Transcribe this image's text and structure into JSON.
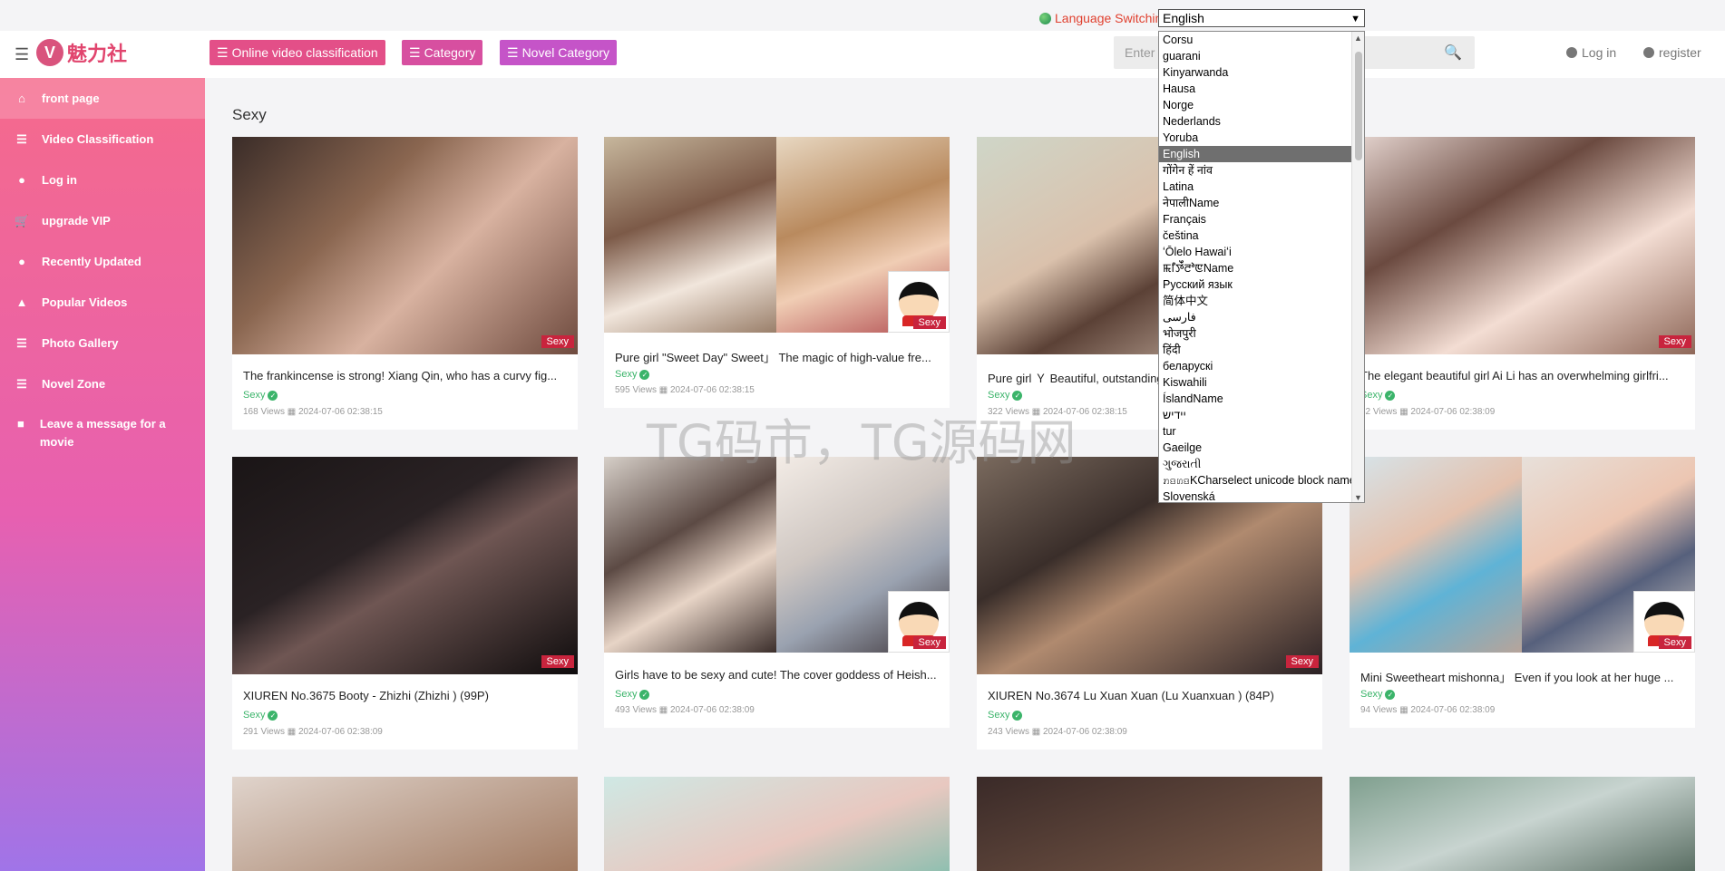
{
  "language": {
    "label": "Language Switching",
    "selected": "English",
    "options": [
      "Corsu",
      "guarani",
      "Kinyarwanda",
      "Hausa",
      "Norge",
      "Nederlands",
      "Yoruba",
      "English",
      "गोंगेन हें नांव",
      "Latina",
      "नेपालीName",
      "Français",
      "čeština",
      "ʻŌlelo Hawaiʻi",
      "ꯃꯤꯇꯩꯂꯣꯟName",
      "Русский язык",
      "简体中文",
      "فارسی",
      "भोजपुरी",
      "हिंदी",
      "беларускі",
      "Kiswahili",
      "ÍslandName",
      "יידיש",
      "tur",
      "Gaeilge",
      "ગુજરાતી",
      "ꤊꤢꤛꤢKCharselect unicode block name",
      "Slovenská"
    ]
  },
  "header": {
    "logo_letter": "V",
    "logo_text": "魅力社",
    "nav": [
      "Online video classification",
      "Category",
      "Novel Category"
    ],
    "search_placeholder": "Enter",
    "login": "Log in",
    "register": "register"
  },
  "sidebar": {
    "items": [
      {
        "label": "front page",
        "icon": "home-icon"
      },
      {
        "label": "Video Classification",
        "icon": "list-icon"
      },
      {
        "label": "Log in",
        "icon": "user-circle-icon"
      },
      {
        "label": "upgrade VIP",
        "icon": "cart-icon"
      },
      {
        "label": "Recently Updated",
        "icon": "user-icon"
      },
      {
        "label": "Popular Videos",
        "icon": "fire-icon"
      },
      {
        "label": "Photo Gallery",
        "icon": "list-icon"
      },
      {
        "label": "Novel Zone",
        "icon": "list-icon"
      },
      {
        "label": "Leave a message for a movie",
        "icon": "clipboard-icon"
      }
    ]
  },
  "section_title": "Sexy",
  "watermark": "TG码市，TG源码网",
  "cards": [
    {
      "title": "The frankincense is strong! Xiang Qin, who has a curvy fig...",
      "tag": "Sexy",
      "views": "168 Views",
      "date": "2024-07-06 02:38:15",
      "badge": "Sexy"
    },
    {
      "title": "Pure girl \"Sweet Day\" Sweet」 The magic of high-value fre...",
      "tag": "Sexy",
      "views": "595 Views",
      "date": "2024-07-06 02:38:15",
      "badge": "Sexy"
    },
    {
      "title": "Pure girl Ｙ Beautiful, outstanding",
      "tag": "Sexy",
      "views": "322 Views",
      "date": "2024-07-06 02:38:15",
      "badge": ""
    },
    {
      "title": "The elegant beautiful girl Ai Li has an overwhelming girlfri...",
      "tag": "Sexy",
      "views": "32 Views",
      "date": "2024-07-06 02:38:09",
      "badge": "Sexy"
    },
    {
      "title": "XIUREN No.3675 Booty - Zhizhi (Zhizhi ) (99P)",
      "tag": "Sexy",
      "views": "291 Views",
      "date": "2024-07-06 02:38:09",
      "badge": "Sexy"
    },
    {
      "title": "Girls have to be sexy and cute! The cover goddess of Heish...",
      "tag": "Sexy",
      "views": "493 Views",
      "date": "2024-07-06 02:38:09",
      "badge": "Sexy"
    },
    {
      "title": "XIUREN No.3674 Lu Xuan Xuan (Lu Xuanxuan ) (84P)",
      "tag": "Sexy",
      "views": "243 Views",
      "date": "2024-07-06 02:38:09",
      "badge": "Sexy"
    },
    {
      "title": "Mini Sweetheart mishonna」 Even if you look at her huge ...",
      "tag": "Sexy",
      "views": "94 Views",
      "date": "2024-07-06 02:38:09",
      "badge": "Sexy"
    }
  ]
}
